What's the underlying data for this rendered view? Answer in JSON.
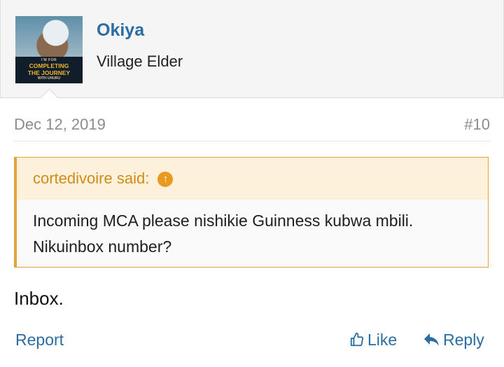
{
  "user": {
    "name": "Okiya",
    "title": "Village Elder",
    "avatar_banner": {
      "line1": "I'M FOR",
      "line2": "COMPLETING",
      "line3": "THE JOURNEY",
      "line4": "WITH UHURU"
    }
  },
  "post": {
    "date": "Dec 12, 2019",
    "number": "#10",
    "quote": {
      "author_label": "cortedivoire said:",
      "line1": "Incoming MCA please nishikie Guinness kubwa mbili.",
      "line2": "Nikuinbox number?"
    },
    "text": "Inbox."
  },
  "actions": {
    "report": "Report",
    "like": "Like",
    "reply": "Reply"
  },
  "colors": {
    "link": "#2b6ca3",
    "quote_accent": "#e1a43b",
    "quote_head_bg": "#fdf1dc"
  }
}
